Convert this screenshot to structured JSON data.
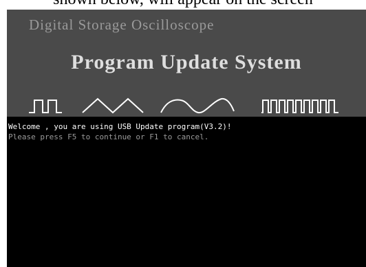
{
  "caption": "shown below, will appear on the screen",
  "screen": {
    "subtitle": "Digital Storage Oscilloscope",
    "title": "Program Update System",
    "wave_icons": [
      "square-wave-icon",
      "triangle-wave-icon",
      "sine-wave-icon",
      "pulse-train-icon"
    ],
    "console": {
      "line1": "Welcome , you are using USB Update program(V3.2)!",
      "line2": "Please press  F5 to continue or F1  to cancel."
    }
  },
  "colors": {
    "header_bg": "#4a4a4a",
    "screen_bg": "#000000",
    "title": "#dedede",
    "subtitle": "#9a9a9a",
    "waveform": "#ffffff",
    "console_text": "#ffffff",
    "console_hint": "#9a9a9a"
  }
}
